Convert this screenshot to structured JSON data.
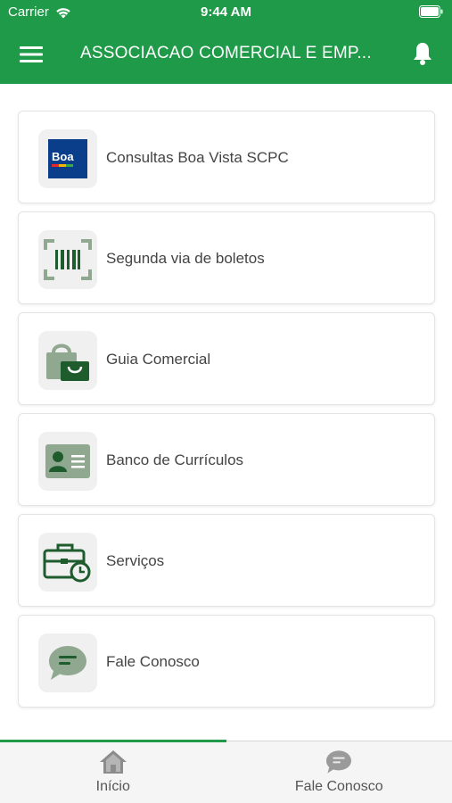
{
  "status_bar": {
    "carrier": "Carrier",
    "time": "9:44 AM"
  },
  "nav": {
    "title": "ASSOCIACAO COMERCIAL E EMP...",
    "menu_icon": "hamburger-menu-icon",
    "bell_icon": "bell-icon"
  },
  "cards": [
    {
      "label": "Consultas Boa Vista SCPC",
      "icon": "boa-vista-logo",
      "logo_text": "Boa"
    },
    {
      "label": "Segunda via de boletos",
      "icon": "barcode-scan-icon"
    },
    {
      "label": "Guia Comercial",
      "icon": "shopping-bag-icon"
    },
    {
      "label": "Banco de Currículos",
      "icon": "id-card-icon"
    },
    {
      "label": "Serviços",
      "icon": "briefcase-clock-icon"
    },
    {
      "label": "Fale Conosco",
      "icon": "chat-bubble-icon"
    }
  ],
  "tabbar": {
    "tabs": [
      {
        "label": "Início",
        "icon": "home-icon",
        "active": true
      },
      {
        "label": "Fale Conosco",
        "icon": "chat-bubble-icon",
        "active": false
      }
    ]
  },
  "colors": {
    "primary": "#1f9a48",
    "icon_green": "#8fa88f",
    "icon_dark_green": "#1e5c2e",
    "boa_blue": "#0b3e8a"
  }
}
